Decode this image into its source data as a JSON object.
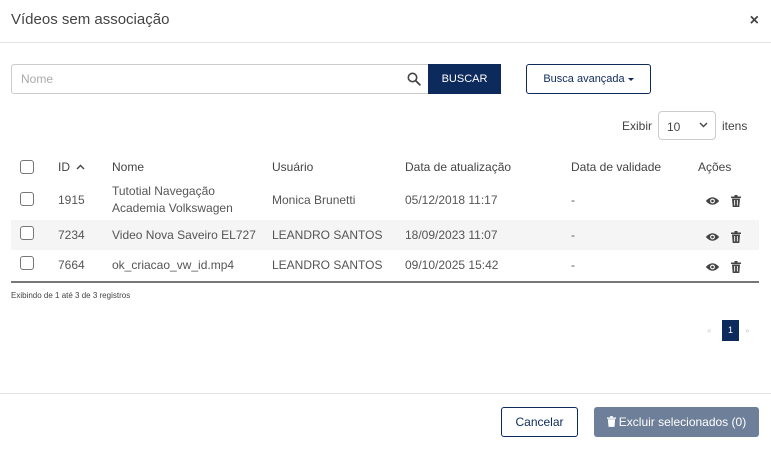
{
  "modal": {
    "title": "Vídeos sem associação",
    "close_glyph": "×"
  },
  "search": {
    "placeholder": "Nome",
    "value": "",
    "submit_label": "BUSCAR",
    "advanced_label": "Busca avançada"
  },
  "page_size": {
    "prefix": "Exibir",
    "value": "10",
    "suffix": "itens"
  },
  "table": {
    "columns": [
      "ID",
      "Nome",
      "Usuário",
      "Data de atualização",
      "Data de validade",
      "Ações"
    ],
    "sort": {
      "column": "ID",
      "direction": "ascending"
    },
    "rows": [
      {
        "id": "1915",
        "name_line1": "Tutotial Navegação",
        "name_line2": "Academia Volkswagen",
        "user": "Monica Brunetti",
        "updated": "05/12/2018 11:17",
        "validity": "-"
      },
      {
        "id": "7234",
        "name": "Video Nova Saveiro EL727",
        "user": "LEANDRO SANTOS",
        "updated": "18/09/2023 11:07",
        "validity": "-"
      },
      {
        "id": "7664",
        "name": "ok_criacao_vw_id.mp4",
        "user": "LEANDRO SANTOS",
        "updated": "09/10/2025 15:42",
        "validity": "-"
      }
    ],
    "row_actions": [
      "eye-icon",
      "trash-icon"
    ]
  },
  "info_text": "Exibindo de 1 até 3 de 3 registros",
  "pagination": {
    "prev_glyph": "«",
    "current_page": "1",
    "next_glyph": "»"
  },
  "footer": {
    "cancel_label": "Cancelar",
    "delete_label": "Excluir selecionados (0)"
  },
  "colors": {
    "primary": "#0d2a5c",
    "disabled_button": "#6e7f99",
    "stripe": "#f5f5f5"
  }
}
